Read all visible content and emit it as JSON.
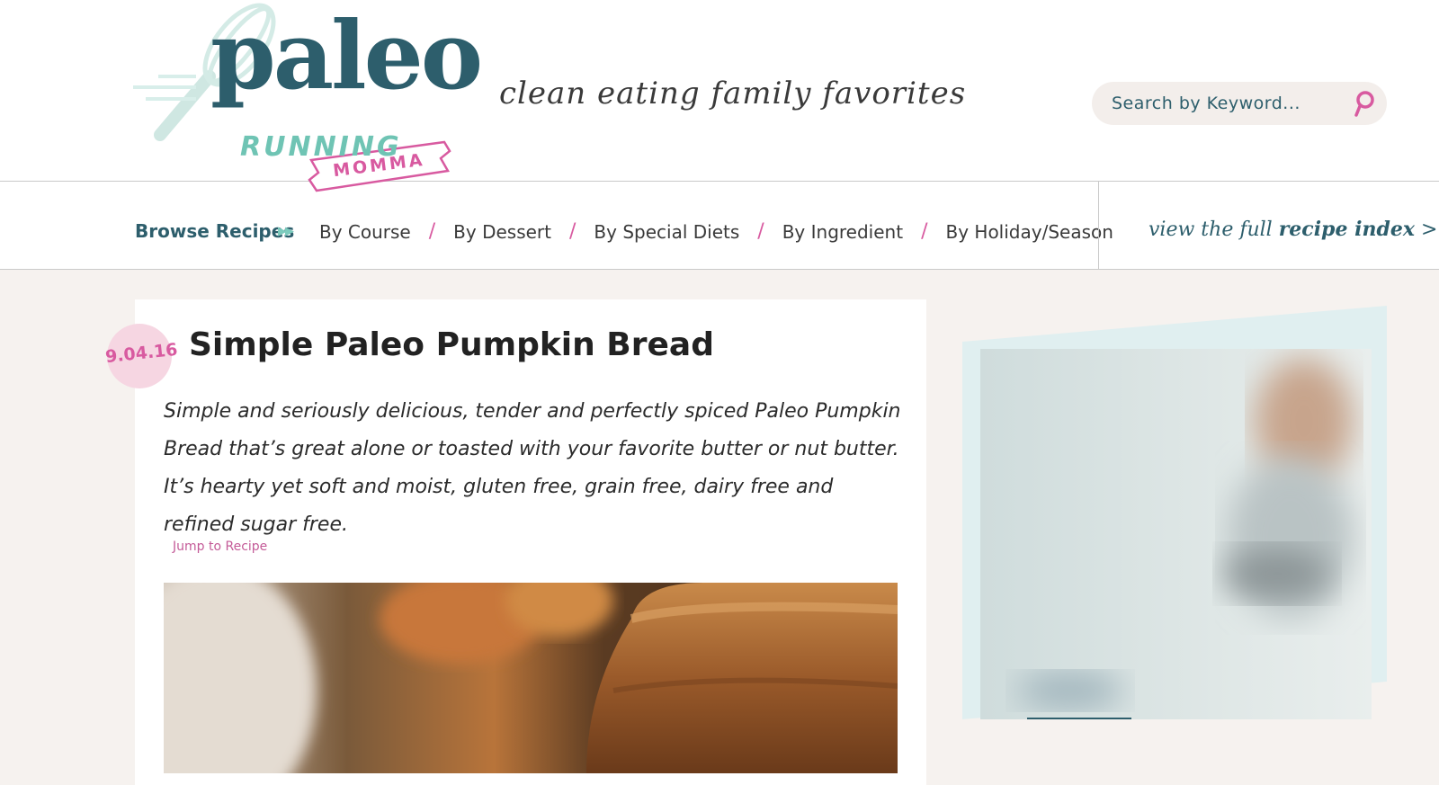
{
  "brand": {
    "logo_primary": "paleo",
    "logo_secondary": "RUNNING",
    "logo_ribbon": "MOMMA",
    "tagline": "clean eating family favorites",
    "colors": {
      "teal_dark": "#2d5e6c",
      "mint": "#6fc4b4",
      "pink": "#d85aa0",
      "cream": "#f6f2ef"
    }
  },
  "search": {
    "placeholder": "Search by Keyword...",
    "value": "",
    "icon": "search-icon"
  },
  "nav": {
    "browse_label": "Browse Recipes",
    "items": [
      {
        "label": "By Course"
      },
      {
        "label": "By Dessert"
      },
      {
        "label": "By Special Diets"
      },
      {
        "label": "By Ingredient"
      },
      {
        "label": "By Holiday/Season"
      }
    ],
    "recipe_index_prefix": "view the full",
    "recipe_index_bold": "recipe index",
    "recipe_index_suffix": ">"
  },
  "post": {
    "date": "9.04.16",
    "title": "Simple Paleo Pumpkin Bread",
    "summary": "Simple and seriously delicious, tender and perfectly spiced Paleo Pumpkin Bread that’s great alone or toasted with your favorite butter or nut butter.  It’s hearty yet soft and moist, gluten free, grain free, dairy free and refined sugar free.",
    "jump_label": "Jump to Recipe"
  }
}
